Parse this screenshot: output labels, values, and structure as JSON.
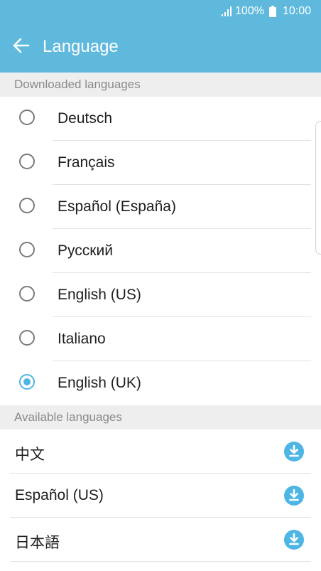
{
  "status_bar": {
    "battery": "100%",
    "time": "10:00",
    "signal_icon": "signal-icon",
    "battery_icon": "battery-icon"
  },
  "app_bar": {
    "back_icon": "back-arrow-icon",
    "title": "Language"
  },
  "downloaded": {
    "header": "Downloaded languages",
    "items": [
      {
        "label": "Deutsch",
        "selected": false
      },
      {
        "label": "Français",
        "selected": false
      },
      {
        "label": "Español (España)",
        "selected": false
      },
      {
        "label": "Русский",
        "selected": false
      },
      {
        "label": "English (US)",
        "selected": false
      },
      {
        "label": "Italiano",
        "selected": false
      },
      {
        "label": "English (UK)",
        "selected": true
      }
    ]
  },
  "available": {
    "header": "Available languages",
    "download_icon": "download-icon",
    "items": [
      {
        "label": "中文"
      },
      {
        "label": "Español (US)"
      },
      {
        "label": "日本語"
      }
    ]
  },
  "colors": {
    "accent": "#5fb9dd",
    "radio_selected": "#4db6e4",
    "section_bg": "#eeeeee"
  }
}
